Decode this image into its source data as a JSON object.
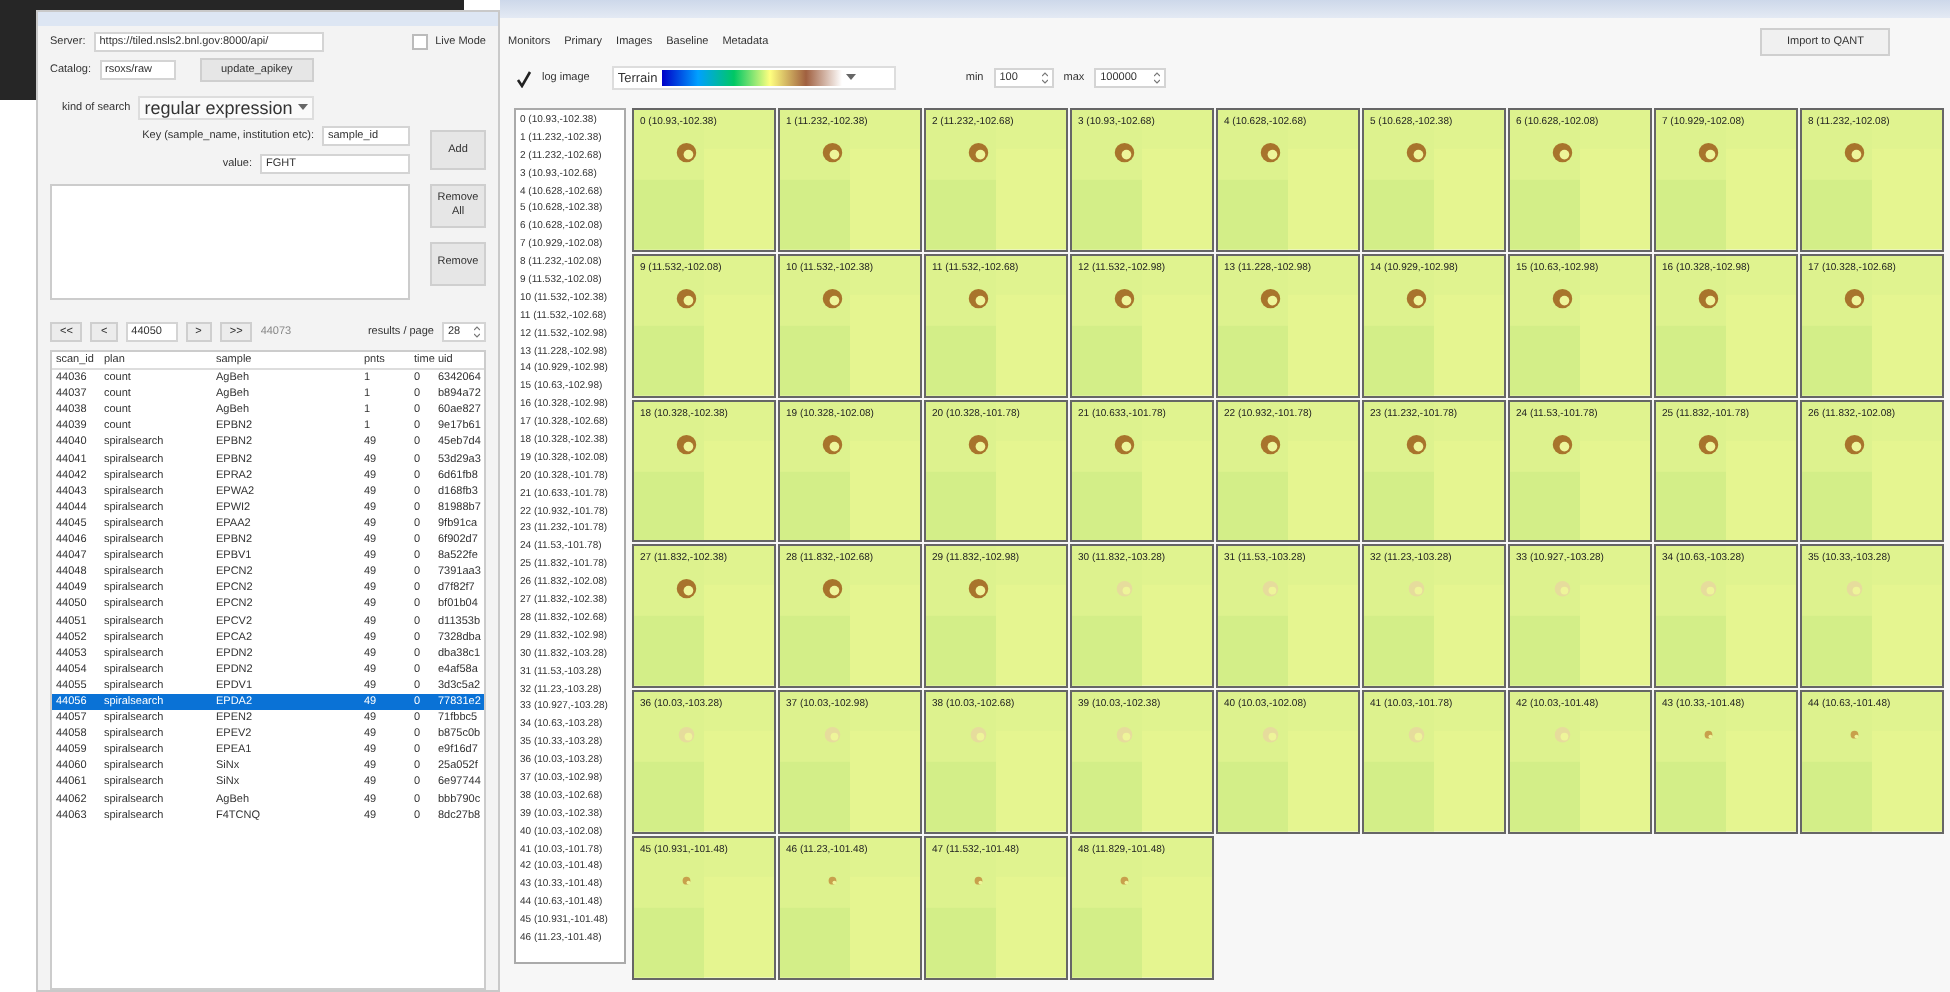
{
  "left": {
    "server": {
      "label": "Server:",
      "value": "https://tiled.nsls2.bnl.gov:8000/api/"
    },
    "live_mode": {
      "label": "Live Mode",
      "checked": false
    },
    "catalog": {
      "label": "Catalog:",
      "value": "rsoxs/raw"
    },
    "update_button": "update_apikey",
    "search_kind": {
      "label": "kind of search",
      "value": "regular expression"
    },
    "key": {
      "label": "Key (sample_name, institution etc):",
      "value": "sample_id"
    },
    "value_field": {
      "label": "value:",
      "value": "FGHT"
    },
    "buttons": {
      "add": "Add",
      "remove_all": "Remove All",
      "remove": "Remove"
    },
    "pager": {
      "first": "<<",
      "prev": "<",
      "page": "44050",
      "next": ">",
      "last": ">>",
      "total": "44073",
      "per_page_label": "results / page",
      "per_page": "28"
    },
    "table": {
      "columns": [
        "scan_id",
        "plan",
        "sample",
        "pnts",
        "time",
        "uid"
      ],
      "rows": [
        {
          "cells": [
            "44036",
            "count",
            "AgBeh",
            "1",
            "0",
            "6342064"
          ],
          "selected": false
        },
        {
          "cells": [
            "44037",
            "count",
            "AgBeh",
            "1",
            "0",
            "b894a72"
          ],
          "selected": false
        },
        {
          "cells": [
            "44038",
            "count",
            "AgBeh",
            "1",
            "0",
            "60ae827"
          ],
          "selected": false
        },
        {
          "cells": [
            "44039",
            "count",
            "EPBN2",
            "1",
            "0",
            "9e17b61"
          ],
          "selected": false
        },
        {
          "cells": [
            "44040",
            "spiralsearch",
            "EPBN2",
            "49",
            "0",
            "45eb7d4"
          ],
          "selected": false
        },
        {
          "cells": [
            "44041",
            "spiralsearch",
            "EPBN2",
            "49",
            "0",
            "53d29a3"
          ],
          "selected": false
        },
        {
          "cells": [
            "44042",
            "spiralsearch",
            "EPRA2",
            "49",
            "0",
            "6d61fb8"
          ],
          "selected": false
        },
        {
          "cells": [
            "44043",
            "spiralsearch",
            "EPWA2",
            "49",
            "0",
            "d168fb3"
          ],
          "selected": false
        },
        {
          "cells": [
            "44044",
            "spiralsearch",
            "EPWI2",
            "49",
            "0",
            "81988b7"
          ],
          "selected": false
        },
        {
          "cells": [
            "44045",
            "spiralsearch",
            "EPAA2",
            "49",
            "0",
            "9fb91ca"
          ],
          "selected": false
        },
        {
          "cells": [
            "44046",
            "spiralsearch",
            "EPBN2",
            "49",
            "0",
            "6f902d7"
          ],
          "selected": false
        },
        {
          "cells": [
            "44047",
            "spiralsearch",
            "EPBV1",
            "49",
            "0",
            "8a522fe"
          ],
          "selected": false
        },
        {
          "cells": [
            "44048",
            "spiralsearch",
            "EPCN2",
            "49",
            "0",
            "7391aa3"
          ],
          "selected": false
        },
        {
          "cells": [
            "44049",
            "spiralsearch",
            "EPCN2",
            "49",
            "0",
            "d7f82f7"
          ],
          "selected": false
        },
        {
          "cells": [
            "44050",
            "spiralsearch",
            "EPCN2",
            "49",
            "0",
            "bf01b04"
          ],
          "selected": false
        },
        {
          "cells": [
            "44051",
            "spiralsearch",
            "EPCV2",
            "49",
            "0",
            "d11353b"
          ],
          "selected": false
        },
        {
          "cells": [
            "44052",
            "spiralsearch",
            "EPCA2",
            "49",
            "0",
            "7328dba"
          ],
          "selected": false
        },
        {
          "cells": [
            "44053",
            "spiralsearch",
            "EPDN2",
            "49",
            "0",
            "dba38c1"
          ],
          "selected": false
        },
        {
          "cells": [
            "44054",
            "spiralsearch",
            "EPDN2",
            "49",
            "0",
            "e4af58a"
          ],
          "selected": false
        },
        {
          "cells": [
            "44055",
            "spiralsearch",
            "EPDV1",
            "49",
            "0",
            "3d3c5a2"
          ],
          "selected": false
        },
        {
          "cells": [
            "44056",
            "spiralsearch",
            "EPDA2",
            "49",
            "0",
            "77831e2"
          ],
          "selected": true
        },
        {
          "cells": [
            "44057",
            "spiralsearch",
            "EPEN2",
            "49",
            "0",
            "71fbbc5"
          ],
          "selected": false
        },
        {
          "cells": [
            "44058",
            "spiralsearch",
            "EPEV2",
            "49",
            "0",
            "b875c0b"
          ],
          "selected": false
        },
        {
          "cells": [
            "44059",
            "spiralsearch",
            "EPEA1",
            "49",
            "0",
            "e9f16d7"
          ],
          "selected": false
        },
        {
          "cells": [
            "44060",
            "spiralsearch",
            "SiNx",
            "49",
            "0",
            "25a052f"
          ],
          "selected": false
        },
        {
          "cells": [
            "44061",
            "spiralsearch",
            "SiNx",
            "49",
            "0",
            "6e97744"
          ],
          "selected": false
        },
        {
          "cells": [
            "44062",
            "spiralsearch",
            "AgBeh",
            "49",
            "0",
            "bbb790c"
          ],
          "selected": false
        },
        {
          "cells": [
            "44063",
            "spiralsearch",
            "F4TCNQ",
            "49",
            "0",
            "8dc27b8"
          ],
          "selected": false
        }
      ]
    }
  },
  "right": {
    "tabs": [
      "Monitors",
      "Primary",
      "Images",
      "Baseline",
      "Metadata"
    ],
    "import_button": "Import to QANT",
    "log_image": {
      "label": "log image",
      "checked": true
    },
    "colormap": "Terrain",
    "min": {
      "label": "min",
      "value": "100"
    },
    "max": {
      "label": "max",
      "value": "100000"
    },
    "points": [
      "0 (10.93,-102.38)",
      "1 (11.232,-102.38)",
      "2 (11.232,-102.68)",
      "3 (10.93,-102.68)",
      "4 (10.628,-102.68)",
      "5 (10.628,-102.38)",
      "6 (10.628,-102.08)",
      "7 (10.929,-102.08)",
      "8 (11.232,-102.08)",
      "9 (11.532,-102.08)",
      "10 (11.532,-102.38)",
      "11 (11.532,-102.68)",
      "12 (11.532,-102.98)",
      "13 (11.228,-102.98)",
      "14 (10.929,-102.98)",
      "15 (10.63,-102.98)",
      "16 (10.328,-102.98)",
      "17 (10.328,-102.68)",
      "18 (10.328,-102.38)",
      "19 (10.328,-102.08)",
      "20 (10.328,-101.78)",
      "21 (10.633,-101.78)",
      "22 (10.932,-101.78)",
      "23 (11.232,-101.78)",
      "24 (11.53,-101.78)",
      "25 (11.832,-101.78)",
      "26 (11.832,-102.08)",
      "27 (11.832,-102.38)",
      "28 (11.832,-102.68)",
      "29 (11.832,-102.98)",
      "30 (11.832,-103.28)",
      "31 (11.53,-103.28)",
      "32 (11.23,-103.28)",
      "33 (10.927,-103.28)",
      "34 (10.63,-103.28)",
      "35 (10.33,-103.28)",
      "36 (10.03,-103.28)",
      "37 (10.03,-102.98)",
      "38 (10.03,-102.68)",
      "39 (10.03,-102.38)",
      "40 (10.03,-102.08)",
      "41 (10.03,-101.78)",
      "42 (10.03,-101.48)",
      "43 (10.33,-101.48)",
      "44 (10.63,-101.48)",
      "45 (10.931,-101.48)",
      "46 (11.23,-101.48)"
    ],
    "tiles": [
      {
        "label": "0 (10.93,-102.38)",
        "kind": "bright"
      },
      {
        "label": "1 (11.232,-102.38)",
        "kind": "bright"
      },
      {
        "label": "2 (11.232,-102.68)",
        "kind": "bright"
      },
      {
        "label": "3 (10.93,-102.68)",
        "kind": "bright"
      },
      {
        "label": "4 (10.628,-102.68)",
        "kind": "bright"
      },
      {
        "label": "5 (10.628,-102.38)",
        "kind": "bright"
      },
      {
        "label": "6 (10.628,-102.08)",
        "kind": "bright"
      },
      {
        "label": "7 (10.929,-102.08)",
        "kind": "bright"
      },
      {
        "label": "8 (11.232,-102.08)",
        "kind": "bright"
      },
      {
        "label": "9 (11.532,-102.08)",
        "kind": "bright"
      },
      {
        "label": "10 (11.532,-102.38)",
        "kind": "bright"
      },
      {
        "label": "11 (11.532,-102.68)",
        "kind": "bright"
      },
      {
        "label": "12 (11.532,-102.98)",
        "kind": "bright"
      },
      {
        "label": "13 (11.228,-102.98)",
        "kind": "bright"
      },
      {
        "label": "14 (10.929,-102.98)",
        "kind": "bright"
      },
      {
        "label": "15 (10.63,-102.98)",
        "kind": "bright"
      },
      {
        "label": "16 (10.328,-102.98)",
        "kind": "bright"
      },
      {
        "label": "17 (10.328,-102.68)",
        "kind": "bright"
      },
      {
        "label": "18 (10.328,-102.38)",
        "kind": "bright"
      },
      {
        "label": "19 (10.328,-102.08)",
        "kind": "bright"
      },
      {
        "label": "20 (10.328,-101.78)",
        "kind": "bright"
      },
      {
        "label": "21 (10.633,-101.78)",
        "kind": "bright"
      },
      {
        "label": "22 (10.932,-101.78)",
        "kind": "bright"
      },
      {
        "label": "23 (11.232,-101.78)",
        "kind": "bright"
      },
      {
        "label": "24 (11.53,-101.78)",
        "kind": "bright"
      },
      {
        "label": "25 (11.832,-101.78)",
        "kind": "bright"
      },
      {
        "label": "26 (11.832,-102.08)",
        "kind": "bright"
      },
      {
        "label": "27 (11.832,-102.38)",
        "kind": "bright"
      },
      {
        "label": "28 (11.832,-102.68)",
        "kind": "bright"
      },
      {
        "label": "29 (11.832,-102.98)",
        "kind": "bright"
      },
      {
        "label": "30 (11.832,-103.28)",
        "kind": "faint"
      },
      {
        "label": "31 (11.53,-103.28)",
        "kind": "faint"
      },
      {
        "label": "32 (11.23,-103.28)",
        "kind": "faint"
      },
      {
        "label": "33 (10.927,-103.28)",
        "kind": "faint"
      },
      {
        "label": "34 (10.63,-103.28)",
        "kind": "faint"
      },
      {
        "label": "35 (10.33,-103.28)",
        "kind": "faint"
      },
      {
        "label": "36 (10.03,-103.28)",
        "kind": "faint"
      },
      {
        "label": "37 (10.03,-102.98)",
        "kind": "faint"
      },
      {
        "label": "38 (10.03,-102.68)",
        "kind": "faint"
      },
      {
        "label": "39 (10.03,-102.38)",
        "kind": "faint"
      },
      {
        "label": "40 (10.03,-102.08)",
        "kind": "faint"
      },
      {
        "label": "41 (10.03,-101.78)",
        "kind": "faint"
      },
      {
        "label": "42 (10.03,-101.48)",
        "kind": "faint"
      },
      {
        "label": "43 (10.33,-101.48)",
        "kind": "dot"
      },
      {
        "label": "44 (10.63,-101.48)",
        "kind": "dot"
      },
      {
        "label": "45 (10.931,-101.48)",
        "kind": "dot"
      },
      {
        "label": "46 (11.23,-101.48)",
        "kind": "dot"
      },
      {
        "label": "47 (11.532,-101.48)",
        "kind": "dot"
      },
      {
        "label": "48 (11.829,-101.48)",
        "kind": "dot"
      }
    ]
  }
}
